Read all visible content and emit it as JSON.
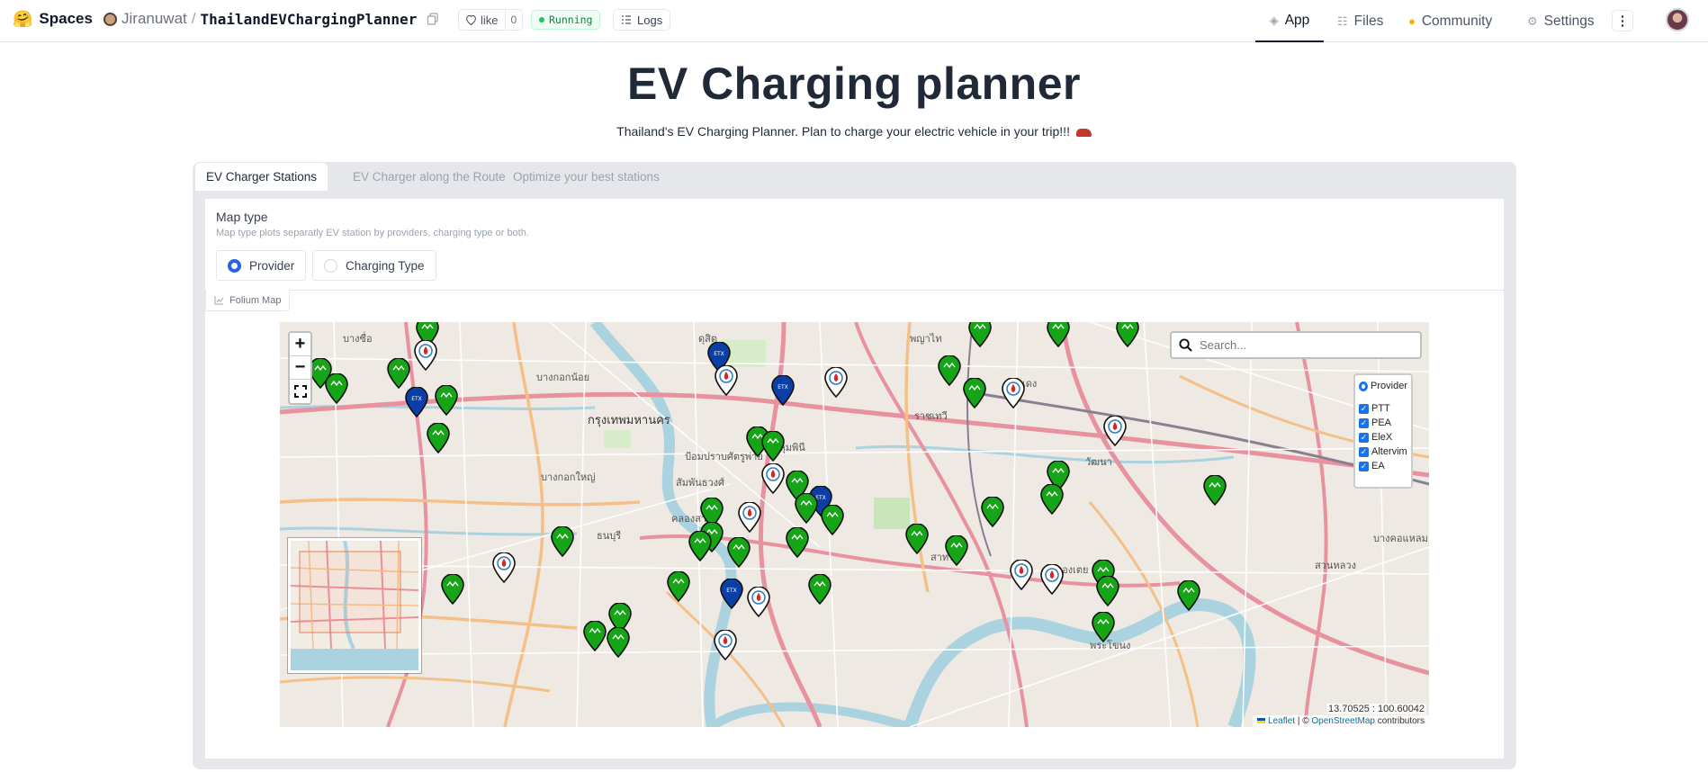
{
  "topbar": {
    "spaces_label": "Spaces",
    "owner": "Jiranuwat",
    "repo_name": "ThailandEVChargingPlanner",
    "like_label": "like",
    "like_count": "0",
    "status": "Running",
    "logs_label": "Logs",
    "nav": {
      "app": "App",
      "files": "Files",
      "community": "Community",
      "settings": "Settings"
    }
  },
  "header": {
    "title": "EV Charging planner",
    "description": "Thailand's EV Charging Planner. Plan to charge your electric vehicle in your trip!!!"
  },
  "tabs": [
    "EV Charger Stations",
    "EV Charger along the Route",
    "Optimize your best stations"
  ],
  "map_type": {
    "label": "Map type",
    "info": "Map type plots separatly EV station by providers, charging type or both.",
    "options": [
      "Provider",
      "Charging Type"
    ],
    "selected": "Provider"
  },
  "html_label": "Folium Map",
  "map": {
    "search_placeholder": "Search...",
    "legend": {
      "group": "Provider",
      "layers": [
        "PTT",
        "PEA",
        "EleX",
        "Altervim",
        "EA"
      ]
    },
    "coordinates": "13.70525 : 100.60042",
    "attribution": {
      "leaflet": "Leaflet",
      "osm": "OpenStreetMap",
      "suffix": "contributors"
    },
    "place_labels": [
      "กรุงเทพมหานคร",
      "พญาไท",
      "ดินแดง",
      "ราชเทวี",
      "วัฒนา",
      "บางกอกน้อย",
      "บางกอกใหญ่",
      "ธนบุรี",
      "คลองเตย",
      "สวนหลวง",
      "สาทร",
      "ป้อมปราบศัตรูพ่าย",
      "สัมพันธวงศ์",
      "คลองสาน",
      "บางซื่อ",
      "ดุสิต",
      "ลุมพินี",
      "บางคอแหลม",
      "พระโขนง"
    ],
    "provider_colors": {
      "PTT": "#ffffff",
      "PEA": "#ffffff",
      "EleX": "#0b3fa8",
      "EA": "#16a516",
      "road_major": "#e8929f",
      "road_secondary": "#f4c087",
      "water": "#aad3df",
      "park": "#c8e6b9"
    }
  }
}
